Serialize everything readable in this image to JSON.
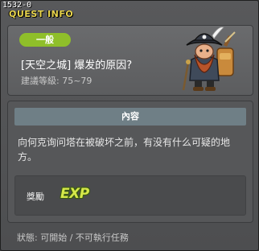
{
  "window": {
    "id_label": "1532-0",
    "title": "QUEST INFO"
  },
  "quest": {
    "category": "一般",
    "name": "[天空之城] 爆发的原因?",
    "level_text": "建議等級: 75~79"
  },
  "content": {
    "header": "內容",
    "description": "向何克询问塔在被破坏之前，有没有什么可疑的地方。"
  },
  "reward": {
    "label": "獎勵",
    "icon_text": "EXP"
  },
  "status": {
    "text": "狀態: 可開始 / 不可執行任務"
  },
  "colors": {
    "title": "#e8d44d",
    "badge": "#8fbf2a",
    "content_header": "#6f7f86",
    "exp": "#d6e84a"
  },
  "icons": {
    "npc": "pirate-npc-icon",
    "reward": "exp-icon",
    "close": "close-icon"
  }
}
